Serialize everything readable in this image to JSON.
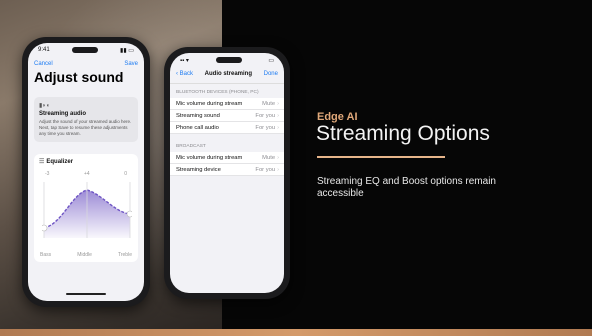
{
  "slide": {
    "kicker": "Edge AI",
    "heading": "Streaming Options",
    "description": "Streaming EQ and Boost options remain accessible"
  },
  "phone1": {
    "status_time": "9:41",
    "nav_cancel": "Cancel",
    "nav_save": "Save",
    "title": "Adjust sound",
    "card_icon": "audio-device-icon",
    "card_heading": "Streaming audio",
    "card_text": "Adjust the sound of your streamed audio here. Next, tap Save to resume these adjustments any time you stream.",
    "equalizer_label": "Equalizer",
    "scale": [
      "-3",
      "+4",
      "0"
    ],
    "band_labels": [
      "Bass",
      "Middle",
      "Treble"
    ],
    "eq_values": [
      -3,
      4,
      0
    ]
  },
  "phone2": {
    "nav_back": "Back",
    "nav_title": "Audio streaming",
    "nav_done": "Done",
    "section1": "BLUETOOTH DEVICES (PHONE, PC)",
    "rows1": [
      {
        "label": "Mic volume during stream",
        "value": "Mute"
      },
      {
        "label": "Streaming sound",
        "value": "For you"
      },
      {
        "label": "Phone call audio",
        "value": "For you"
      }
    ],
    "section2": "BROADCAST",
    "rows2": [
      {
        "label": "Mic volume during stream",
        "value": "Mute"
      },
      {
        "label": "Streaming device",
        "value": "For you"
      }
    ]
  },
  "colors": {
    "accent": "#e0a87a",
    "ios_blue": "#1e7cf2",
    "eq_purple": "#7b64c8"
  }
}
